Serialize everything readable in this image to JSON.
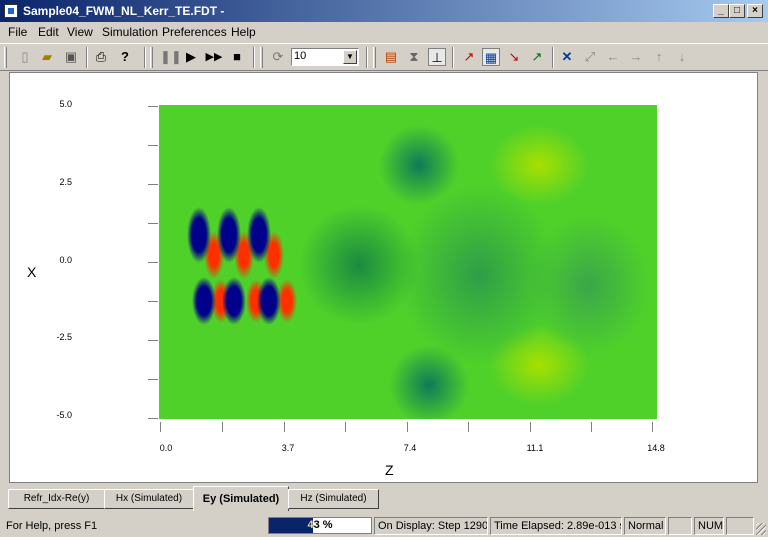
{
  "window": {
    "title": "Sample04_FWM_NL_Kerr_TE.FDT -",
    "controls": [
      "minimize",
      "maximize",
      "close"
    ]
  },
  "menu": [
    "File",
    "Edit",
    "View",
    "Simulation",
    "Preferences",
    "Help"
  ],
  "toolbar": {
    "combo_value": "10",
    "icons": [
      "new-icon",
      "open-icon",
      "save-icon",
      "print-icon",
      "help-icon",
      "pause-icon",
      "play-icon",
      "step-icon",
      "stop-icon",
      "refresh-icon",
      "color-map-icon",
      "hourglass-icon",
      "axis-icon",
      "zoom-z-icon",
      "colorbar-icon",
      "chart-x-icon",
      "chart-check-icon",
      "zoom-in-icon",
      "zoom-fit-icon",
      "arrow-left-icon",
      "arrow-right-icon",
      "arrow-up-icon",
      "arrow-down-icon"
    ]
  },
  "plot": {
    "xlabel": "Z",
    "ylabel": "X",
    "x_ticks": [
      "0.0",
      "3.7",
      "7.4",
      "11.1",
      "14.8"
    ],
    "y_ticks": [
      "5.0",
      "2.5",
      "0.0",
      "-2.5",
      "-5.0"
    ]
  },
  "tabs": [
    "Refr_Idx-Re(y)",
    "Hx (Simulated)",
    "Ey (Simulated)",
    "Hz (Simulated)"
  ],
  "active_tab": "Ey (Simulated)",
  "status": {
    "help": "For Help, press F1",
    "progress_text": "43 %",
    "progress_value": 0.43,
    "display": "On Display: Step 1290",
    "elapsed": "Time Elapsed: 2.89e-013 s",
    "mode": "Normal",
    "num": "NUM"
  }
}
